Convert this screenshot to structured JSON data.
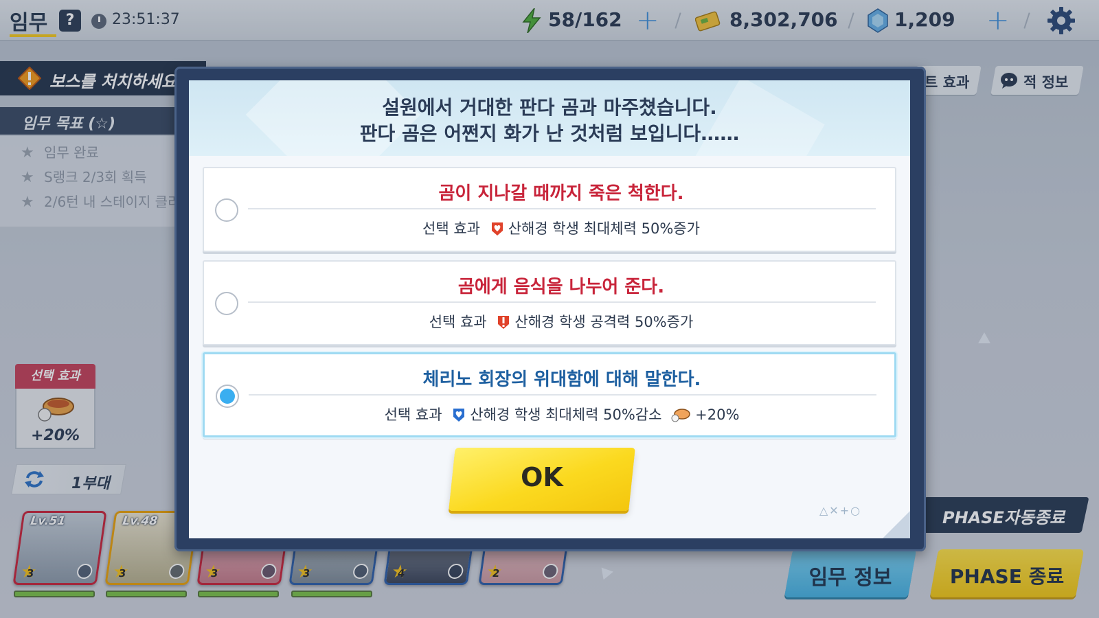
{
  "topbar": {
    "title": "임무",
    "help_label": "?",
    "timer": "23:51:37",
    "stamina": "58/162",
    "credits": "8,302,706",
    "gems": "1,209",
    "plus_label": "+"
  },
  "left_panel": {
    "boss_banner": "보스를 처치하세요",
    "mission_goal_header": "임무 목표 (☆)",
    "missions": [
      "임무 완료",
      "S랭크 2/3회 획득",
      "2/6턴 내 스테이지 클리어"
    ],
    "effect_tag": "선택 효과",
    "effect_value": "+20%",
    "squad_label": "1부대"
  },
  "team_cards": [
    {
      "level": "Lv.51",
      "stars": "3",
      "border": "#c8263b"
    },
    {
      "level": "Lv.48",
      "stars": "3",
      "border": "#e8a10b"
    },
    {
      "level": "",
      "stars": "3",
      "border": "#c8263b"
    },
    {
      "level": "",
      "stars": "3",
      "border": "#2f5fa8"
    },
    {
      "level": "",
      "stars": "4",
      "border": "#2f5fa8"
    },
    {
      "level": "",
      "stars": "2",
      "border": "#2f5fa8"
    }
  ],
  "right_panel": {
    "tab_effect": "트 효과",
    "tab_enemy": "적 정보",
    "phase_auto": "PHASE자동종료",
    "mission_info": "임무 정보",
    "phase_end": "PHASE 종료"
  },
  "dialog": {
    "prompt_line1": "설원에서 거대한 판다 곰과 마주쳤습니다.",
    "prompt_line2": "판다 곰은 어쩐지 화가 난 것처럼 보입니다……",
    "effect_prefix": "선택 효과",
    "options": [
      {
        "title": "곰이 지나갈 때까지 죽은 척한다.",
        "effect": "산해경 학생 최대체력 50%증가",
        "badge_color": "#e0432b",
        "selected": false
      },
      {
        "title": "곰에게 음식을 나누어 준다.",
        "effect": "산해경 학생 공격력 50%증가",
        "badge_color": "#e0432b",
        "selected": false
      },
      {
        "title": "체리노 회장의 위대함에 대해 말한다.",
        "effect": "산해경 학생 최대체력 50%감소",
        "bonus": "+20%",
        "badge_color": "#2a6fd0",
        "selected": true
      }
    ],
    "ok_label": "OK",
    "deco_shapes": "△✕+○"
  },
  "colors": {
    "accent_yellow": "#f7d21a",
    "accent_blue": "#3aaef0",
    "dialog_frame": "#2b3f62",
    "option_red": "#c8243a",
    "option_blue": "#1d5fa0"
  }
}
